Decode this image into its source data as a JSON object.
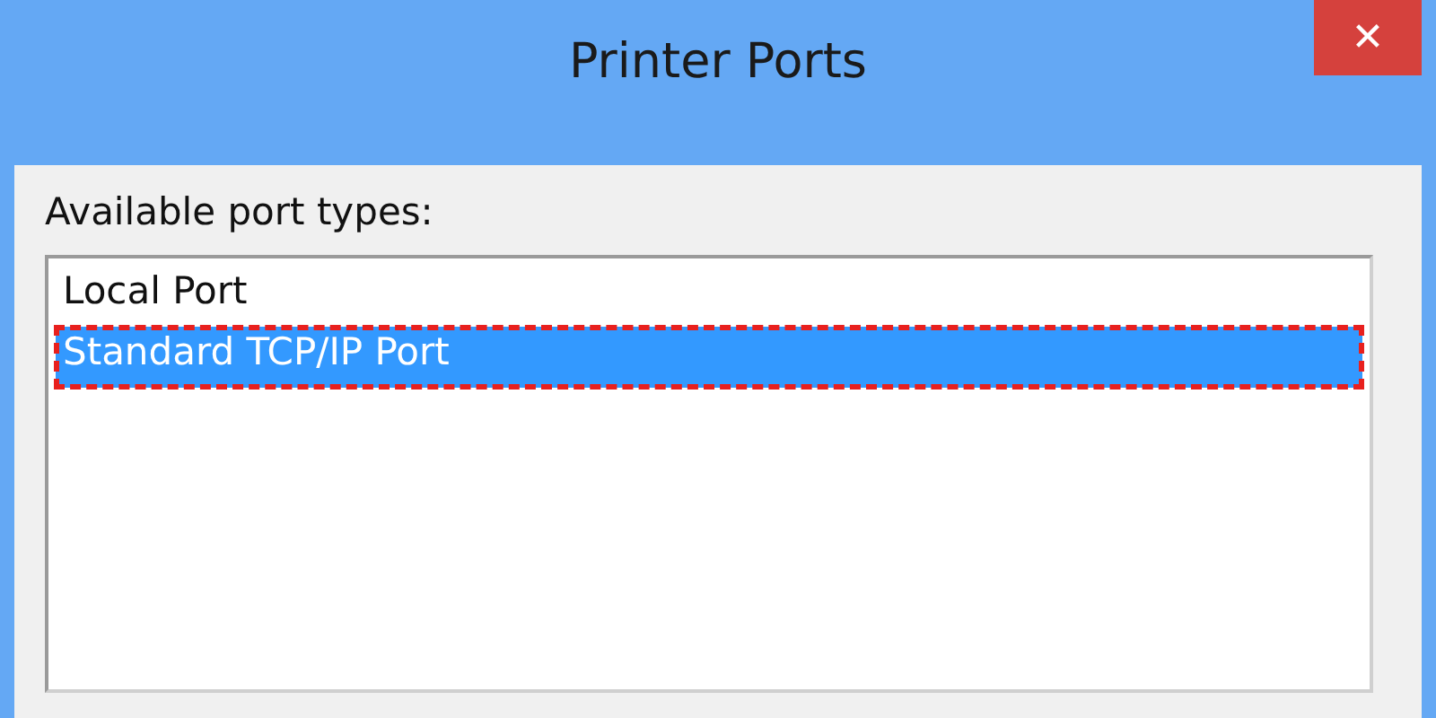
{
  "window": {
    "title": "Printer Ports",
    "close": "✕"
  },
  "list_label": "Available port types:",
  "port_types": [
    {
      "label": "Local Port",
      "selected": false
    },
    {
      "label": "Standard TCP/IP Port",
      "selected": true
    }
  ]
}
